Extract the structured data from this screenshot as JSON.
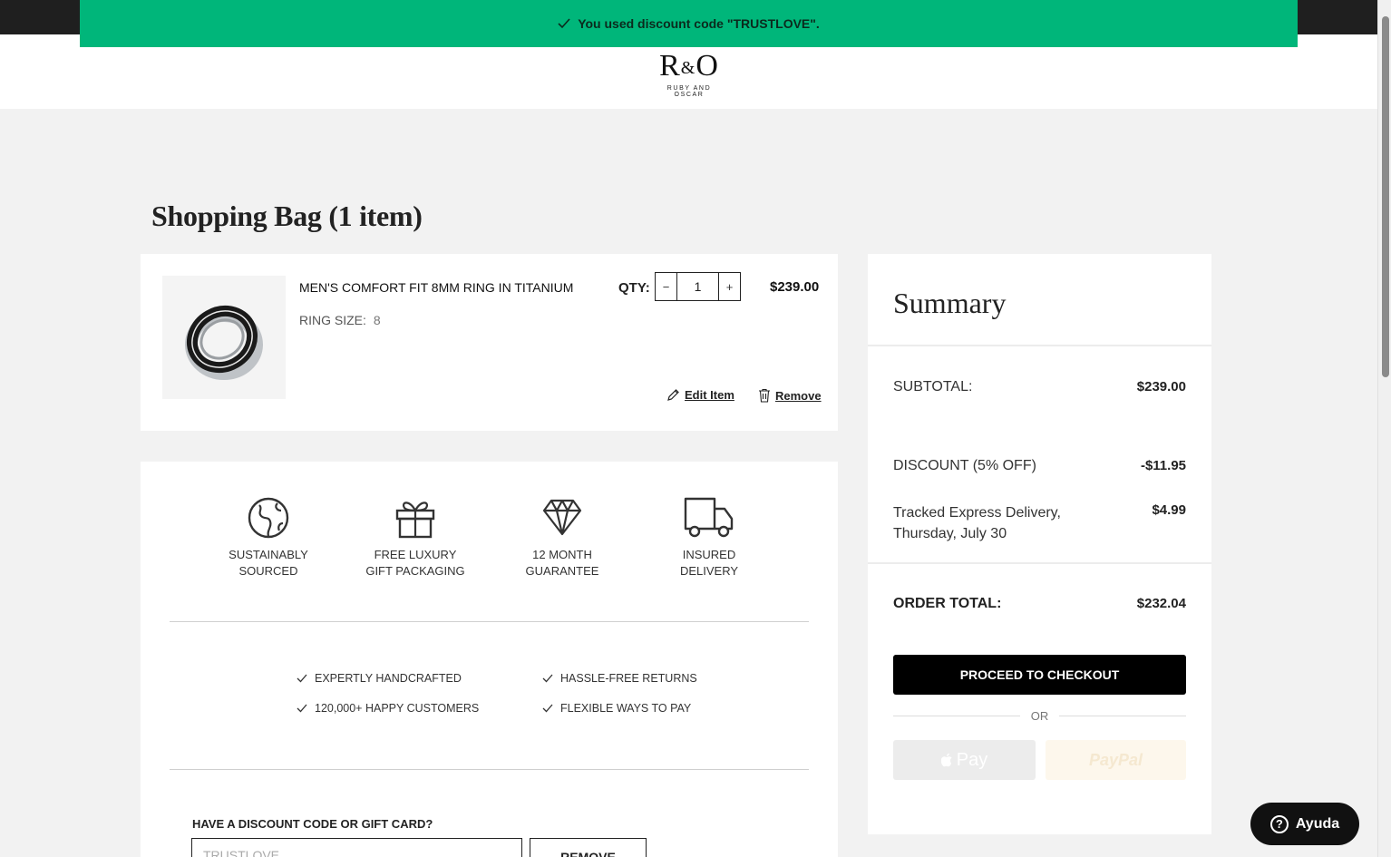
{
  "banner": {
    "message": "You used discount code \"TRUSTLOVE\".",
    "color": "#00b67a"
  },
  "brand": {
    "mark_left": "R",
    "mark_amp": "&",
    "mark_right": "O",
    "name": "RUBY AND OSCAR"
  },
  "page": {
    "title": "Shopping Bag (1 item)"
  },
  "cart_item": {
    "name": "MEN'S COMFORT FIT 8MM RING IN TITANIUM",
    "ring_size_label": "RING SIZE:",
    "ring_size_value": "8",
    "qty_label": "QTY:",
    "qty_value": "1",
    "qty_minus": "−",
    "qty_plus": "+",
    "price": "$239.00",
    "edit_label": "Edit Item",
    "remove_label": "Remove"
  },
  "features": [
    {
      "icon": "globe-icon",
      "line1": "SUSTAINABLY",
      "line2": "SOURCED"
    },
    {
      "icon": "gift-icon",
      "line1": "FREE LUXURY",
      "line2": "GIFT PACKAGING"
    },
    {
      "icon": "diamond-icon",
      "line1": "12 MONTH",
      "line2": "GUARANTEE"
    },
    {
      "icon": "truck-icon",
      "line1": "INSURED",
      "line2": "DELIVERY"
    }
  ],
  "checks": [
    "EXPERTLY HANDCRAFTED",
    "HASSLE-FREE RETURNS",
    "120,000+ HAPPY CUSTOMERS",
    "FLEXIBLE WAYS TO PAY"
  ],
  "discount": {
    "label": "HAVE A DISCOUNT CODE OR GIFT CARD?",
    "value": "TRUSTLOVE",
    "remove_label": "REMOVE"
  },
  "summary": {
    "title": "Summary",
    "subtotal_label": "SUBTOTAL:",
    "subtotal_value": "$239.00",
    "discount_label": "DISCOUNT (5% OFF)",
    "discount_value": "-$11.95",
    "delivery_label_line1": "Tracked Express Delivery,",
    "delivery_label_line2": "Thursday, July 30",
    "delivery_value": "$4.99",
    "total_label": "ORDER TOTAL:",
    "total_value": "$232.04",
    "checkout_label": "PROCEED TO CHECKOUT",
    "or_label": "OR",
    "apple_pay_label": "Pay",
    "paypal_label": "PayPal"
  },
  "help": {
    "label": "Ayuda"
  }
}
